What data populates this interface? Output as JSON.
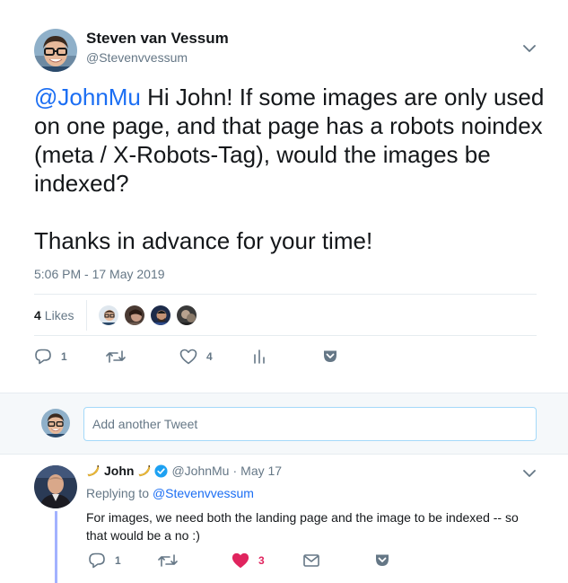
{
  "main_tweet": {
    "author_name": "Steven van Vessum",
    "author_handle": "@Stevenvvessum",
    "mention": "@JohnMu",
    "text_line1": " Hi John! If some images are only used on one page, and that page has a robots noindex (meta / X-Robots-Tag), would the images be indexed?",
    "text_line2": "Thanks in advance for your time!",
    "timestamp": "5:06 PM - 17 May 2019",
    "likes_count": "4",
    "likes_label": "Likes",
    "reply_count": "1",
    "retweet_count": "",
    "like_count": "4"
  },
  "compose": {
    "placeholder": "Add another Tweet"
  },
  "reply_tweet": {
    "author_name": "John",
    "author_handle": "@JohnMu",
    "separator": "·",
    "date": "May 17",
    "replying_prefix": "Replying to ",
    "replying_to": "@Stevenvvessum",
    "text": "For images, we need both the landing page and the image to be indexed -- so that would be a no :)",
    "reply_count": "1",
    "retweet_count": "",
    "like_count": "3"
  },
  "colors": {
    "link": "#1b6ef3",
    "secondary": "#657786",
    "like_active": "#e0245e",
    "verified": "#1da1f2",
    "thread_line": "#a2b2ff"
  },
  "icons": [
    "chevron-down-icon",
    "reply-icon",
    "retweet-icon",
    "heart-icon",
    "analytics-icon",
    "pocket-icon",
    "mail-icon",
    "verified-icon",
    "banana-icon"
  ]
}
